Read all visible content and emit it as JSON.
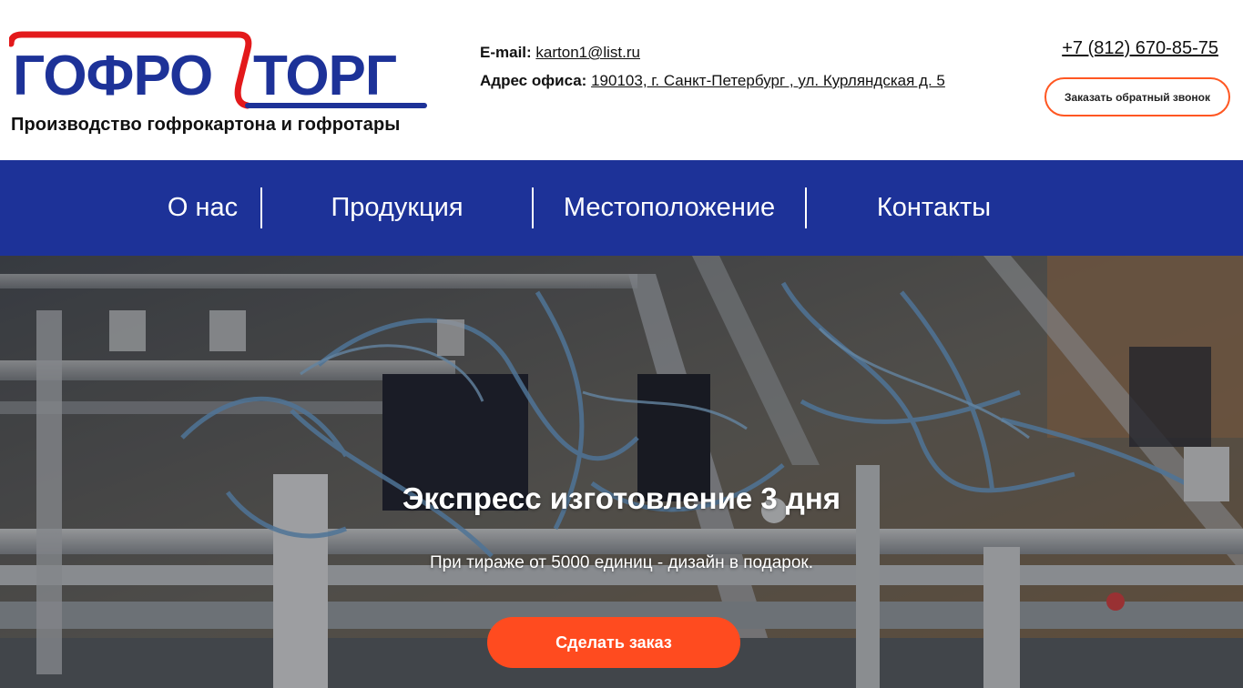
{
  "header": {
    "logo_text_left": "ГОФРО",
    "logo_text_right": "ТОРГ",
    "tagline": "Производство гофрокартона и гофротары",
    "email_label": "E-mail:",
    "email": "karton1@list.ru",
    "address_label": "Адрес офиса:",
    "address": "190103, г. Санкт-Петербург , ул. Курляндская д. 5",
    "phone": "+7 (812) 670-85-75",
    "callback_button": "Заказать обратный звонок"
  },
  "nav": {
    "items": [
      {
        "label": "О нас"
      },
      {
        "label": "Продукция"
      },
      {
        "label": "Местоположение"
      },
      {
        "label": "Контакты"
      }
    ]
  },
  "hero": {
    "title": "Экспресс изготовление 3 дня",
    "subtitle": "При тираже от 5000 единиц - дизайн в подарок.",
    "order_button": "Сделать заказ"
  },
  "colors": {
    "brand_blue": "#1d3298",
    "brand_red": "#e3191b",
    "accent_orange": "#ff4b1f"
  }
}
